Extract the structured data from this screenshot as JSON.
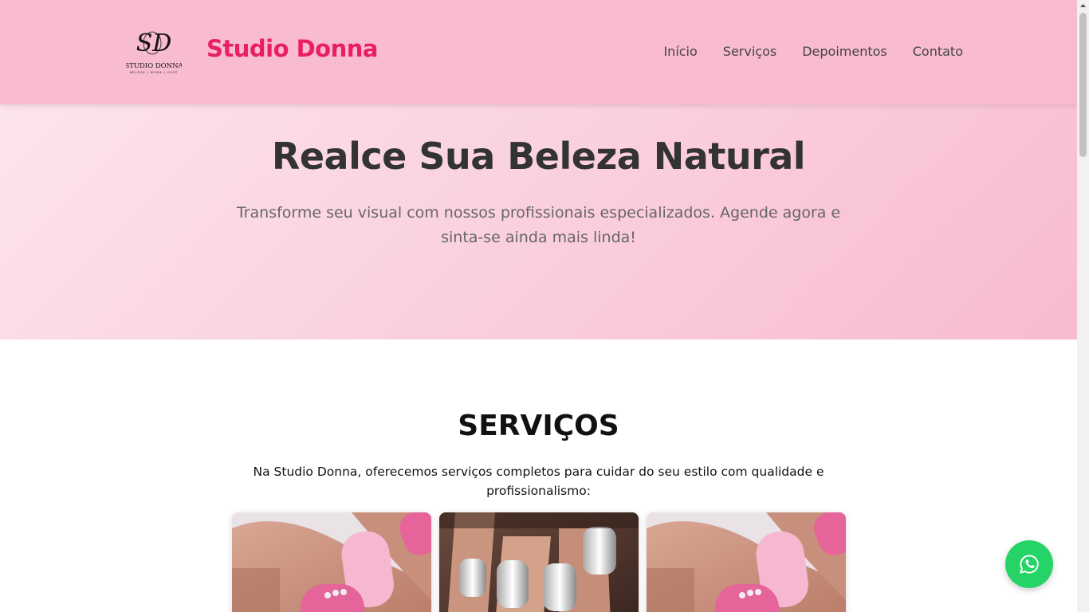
{
  "header": {
    "logo_text": "SD",
    "logo_subtitle": "STUDIO DONNA",
    "logo_tagline": "BELEZA | MODA | CAFÉ",
    "brand": "Studio Donna",
    "nav": [
      "Início",
      "Serviços",
      "Depoimentos",
      "Contato"
    ]
  },
  "hero": {
    "title": "Realce Sua Beleza Natural",
    "subtitle": "Transforme seu visual com nossos profissionais especializados. Agende agora e sinta-se ainda mais linda!"
  },
  "services": {
    "title": "SERVIÇOS",
    "intro": "Na Studio Donna, oferecemos serviços completos para cuidar do seu estilo com qualidade e profissionalismo:",
    "cards": [
      {
        "image": "pink-glitter-nails-photo"
      },
      {
        "image": "chrome-silver-nails-photo"
      },
      {
        "image": "pink-glitter-nails-photo"
      }
    ]
  },
  "colors": {
    "header_bg": "#f8bbd0",
    "brand": "#e91e63",
    "whatsapp": "#25d366"
  },
  "whatsapp": {
    "icon": "whatsapp-icon"
  }
}
